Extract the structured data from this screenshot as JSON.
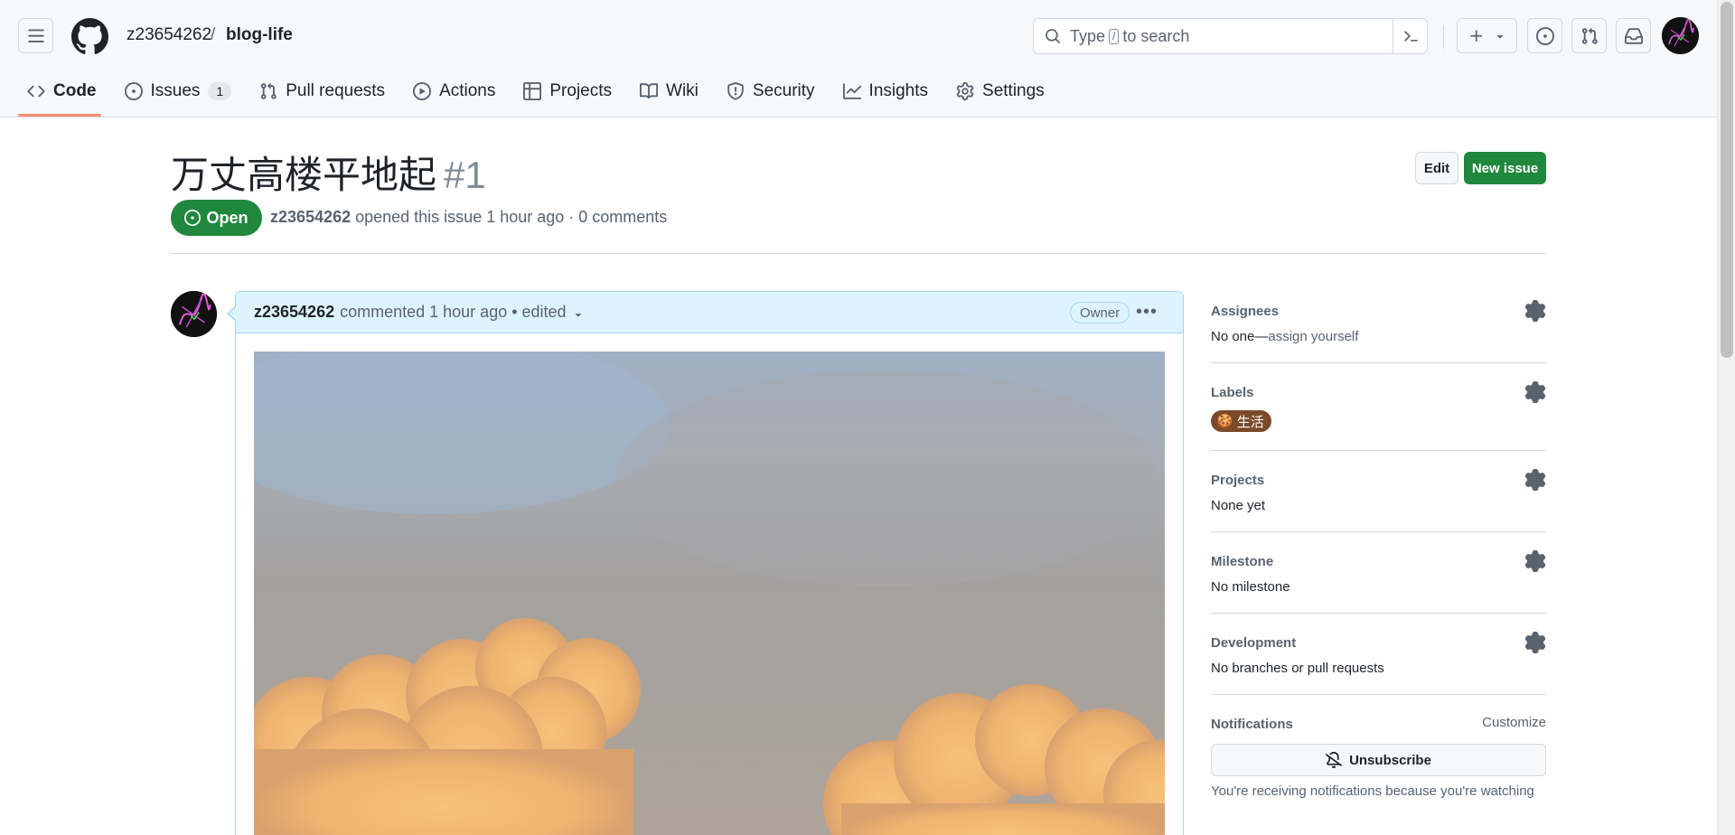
{
  "header": {
    "owner": "z23654262",
    "separator": "/",
    "repo": "blog-life",
    "search_placeholder_pre": "Type",
    "search_key": "/",
    "search_placeholder_post": "to search"
  },
  "tabs": [
    {
      "label": "Code",
      "icon": "code-icon",
      "active": true
    },
    {
      "label": "Issues",
      "icon": "issue-opened-icon",
      "count": "1"
    },
    {
      "label": "Pull requests",
      "icon": "git-pull-request-icon"
    },
    {
      "label": "Actions",
      "icon": "play-icon"
    },
    {
      "label": "Projects",
      "icon": "table-icon"
    },
    {
      "label": "Wiki",
      "icon": "book-icon"
    },
    {
      "label": "Security",
      "icon": "shield-icon"
    },
    {
      "label": "Insights",
      "icon": "graph-icon"
    },
    {
      "label": "Settings",
      "icon": "gear-icon"
    }
  ],
  "issue": {
    "title": "万丈高楼平地起",
    "number": "#1",
    "edit_label": "Edit",
    "new_issue_label": "New issue",
    "state": "Open",
    "author": "z23654262",
    "meta_text": "opened this issue 1 hour ago · 0 comments"
  },
  "comment": {
    "author": "z23654262",
    "meta_text": "commented 1 hour ago • edited",
    "role_badge": "Owner",
    "image_alt": "sunset clouds"
  },
  "sidebar": {
    "assignees": {
      "title": "Assignees",
      "value_pre": "No one—",
      "value_link": "assign yourself"
    },
    "labels": {
      "title": "Labels",
      "items": [
        {
          "name": "生活",
          "emoji": "🍪",
          "color": "#7a4a2b"
        }
      ]
    },
    "projects": {
      "title": "Projects",
      "value": "None yet"
    },
    "milestone": {
      "title": "Milestone",
      "value": "No milestone"
    },
    "development": {
      "title": "Development",
      "value": "No branches or pull requests"
    },
    "notifications": {
      "title": "Notifications",
      "customize": "Customize",
      "button": "Unsubscribe",
      "note": "You're receiving notifications because you're watching"
    }
  },
  "colors": {
    "accent_green": "#1f883d",
    "tab_underline": "#fd8c73",
    "comment_header_bg": "#ddf4ff"
  }
}
